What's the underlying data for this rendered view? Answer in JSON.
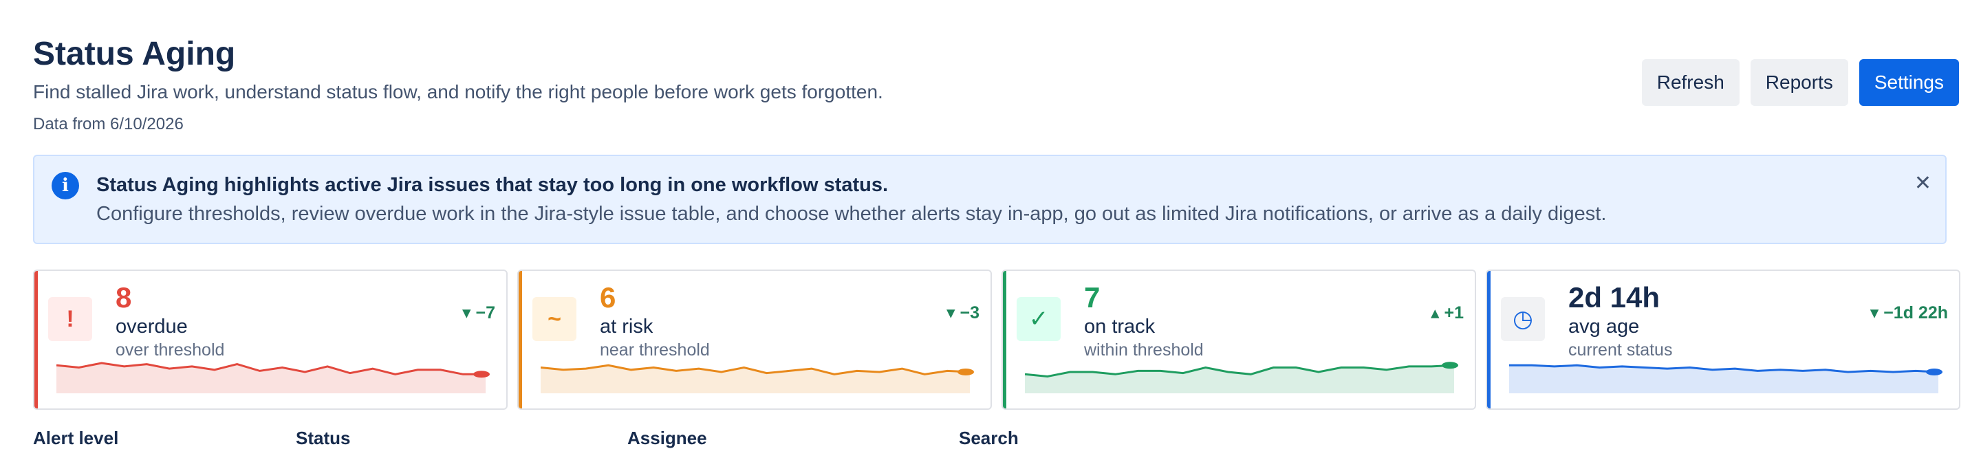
{
  "header": {
    "title": "Status Aging",
    "subtitle": "Find stalled Jira work, understand status flow, and notify the right people before work gets forgotten.",
    "data_from": "Data from 6/10/2026"
  },
  "actions": {
    "refresh_label": "Refresh",
    "reports_label": "Reports",
    "settings_label": "Settings"
  },
  "banner": {
    "icon": "info-icon",
    "title": "Status Aging highlights active Jira issues that stay too long in one workflow status.",
    "body": "Configure thresholds, review overdue work in the Jira-style issue table, and choose whether alerts stay in-app, go out as limited Jira notifications, or arrive as a daily digest.",
    "close_icon": "close-icon"
  },
  "cards": [
    {
      "value": "8",
      "label": "overdue",
      "sublabel": "over threshold",
      "delta": "▾ −7",
      "icon_glyph": "!",
      "icon": "exclamation-icon",
      "color": "#e2483d",
      "tint": "#ffeceb",
      "trend": [
        14,
        12,
        16,
        13,
        15,
        11,
        13,
        10,
        15,
        9,
        12,
        8,
        13,
        7,
        11,
        6,
        10,
        10,
        6,
        6
      ]
    },
    {
      "value": "6",
      "label": "at risk",
      "sublabel": "near threshold",
      "delta": "▾ −3",
      "icon_glyph": "~",
      "icon": "tilde-icon",
      "color": "#e8891b",
      "tint": "#fff3e0",
      "trend": [
        12,
        10,
        11,
        14,
        10,
        12,
        9,
        11,
        8,
        12,
        7,
        9,
        11,
        6,
        9,
        8,
        11,
        6,
        9,
        8
      ]
    },
    {
      "value": "7",
      "label": "on track",
      "sublabel": "within threshold",
      "delta": "▴ +1",
      "icon_glyph": "✓",
      "icon": "check-icon",
      "color": "#1f9d60",
      "tint": "#dcfff1",
      "trend": [
        6,
        4,
        8,
        8,
        6,
        9,
        9,
        7,
        12,
        8,
        6,
        12,
        12,
        8,
        12,
        12,
        10,
        13,
        13,
        14
      ]
    },
    {
      "value": "2d 14h",
      "label": "avg age",
      "sublabel": "current status",
      "delta": "▾ −1d 22h",
      "icon_glyph": "◷",
      "icon": "clock-icon",
      "color": "#1d6ae0",
      "tint": "#f1f2f4",
      "trend": [
        14,
        14,
        13,
        14,
        12,
        13,
        12,
        11,
        12,
        10,
        11,
        9,
        10,
        9,
        10,
        8,
        9,
        8,
        9,
        8
      ]
    }
  ],
  "filters": {
    "alert_level_label": "Alert level",
    "status_label": "Status",
    "assignee_label": "Assignee",
    "search_label": "Search"
  }
}
